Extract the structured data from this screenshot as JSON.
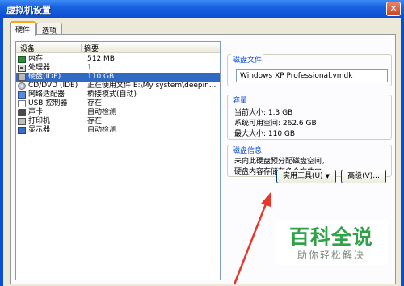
{
  "window": {
    "title": "虚拟机设置",
    "close_glyph": "✕"
  },
  "tabs": [
    {
      "label": "硬件",
      "active": true
    },
    {
      "label": "选项",
      "active": false
    }
  ],
  "device_list": {
    "columns": {
      "device": "设备",
      "summary": "摘要"
    },
    "rows": [
      {
        "icon": "memory-icon",
        "name": "内存",
        "summary": "512 MB",
        "selected": false
      },
      {
        "icon": "cpu-icon",
        "name": "处理器",
        "summary": "1",
        "selected": false
      },
      {
        "icon": "disk-icon",
        "name": "硬盘(IDE)",
        "summary": "110 GB",
        "selected": true
      },
      {
        "icon": "cd-icon",
        "name": "CD/DVD (IDE)",
        "summary": "正在使用文件 E:\\My system\\deepin...",
        "selected": false
      },
      {
        "icon": "network-icon",
        "name": "网络适配器",
        "summary": "桥接模式(自动)",
        "selected": false
      },
      {
        "icon": "usb-icon",
        "name": "USB 控制器",
        "summary": "存在",
        "selected": false
      },
      {
        "icon": "sound-icon",
        "name": "声卡",
        "summary": "自动检测",
        "selected": false
      },
      {
        "icon": "printer-icon",
        "name": "打印机",
        "summary": "存在",
        "selected": false
      },
      {
        "icon": "display-icon",
        "name": "显示器",
        "summary": "自动检测",
        "selected": false
      }
    ]
  },
  "disk_file": {
    "legend": "磁盘文件",
    "value": "Windows XP Professional.vmdk"
  },
  "capacity": {
    "legend": "容量",
    "current": "当前大小: 1.3 GB",
    "available": "系统可用空间: 262.6 GB",
    "max": "最大大小: 110 GB"
  },
  "disk_info": {
    "legend": "磁盘信息",
    "line1": "未向此硬盘预分配磁盘空间。",
    "line2": "硬盘内容存储在多个文件中。"
  },
  "buttons": {
    "utilities": "实用工具(U)",
    "utilities_arrow": "▼",
    "advanced": "高级(V)..."
  },
  "watermark": {
    "title": "百科全说",
    "subtitle": "助你轻松解决"
  },
  "colors": {
    "selection": "#316ac5",
    "legend": "#0046d5",
    "arrow": "#e8362a",
    "watermark": "#2fa24a"
  }
}
